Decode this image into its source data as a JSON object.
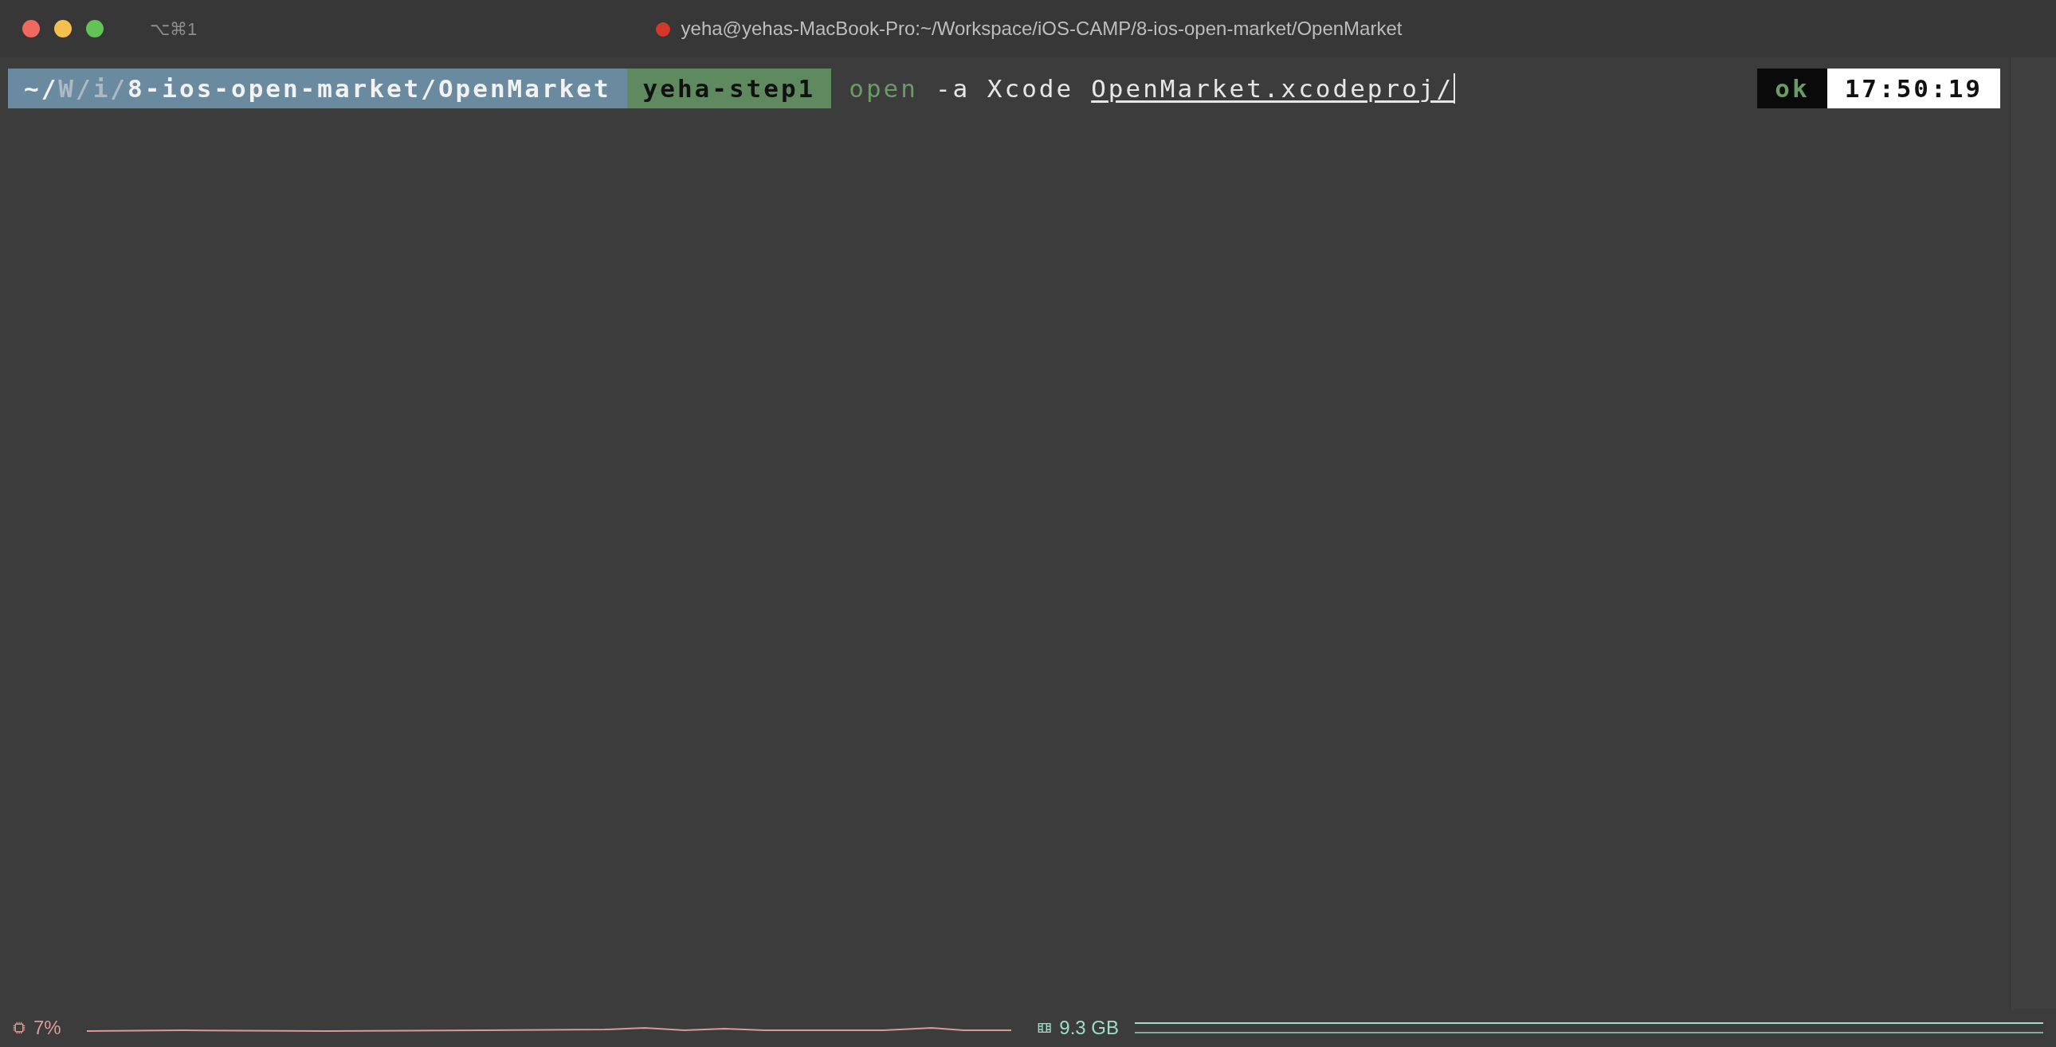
{
  "window": {
    "shortcut": "⌥⌘1",
    "title": "yeha@yehas-MacBook-Pro:~/Workspace/iOS-CAMP/8-ios-open-market/OpenMarket"
  },
  "prompt": {
    "path": [
      {
        "text": "~/",
        "kind": "bright"
      },
      {
        "text": "W/",
        "kind": "dim"
      },
      {
        "text": "i/",
        "kind": "dim"
      },
      {
        "text": "8-ios-open-market/OpenMarket",
        "kind": "bright"
      }
    ],
    "branch": "yeha-step1",
    "command": [
      {
        "text": "open",
        "kind": "program"
      },
      {
        "text": "-a Xcode",
        "kind": "arg"
      },
      {
        "text": "OpenMarket.xcodeproj/",
        "kind": "path"
      }
    ],
    "status": "ok",
    "time": "17:50:19"
  },
  "status_bar": {
    "cpu": "7%",
    "memory": "9.3 GB"
  }
}
